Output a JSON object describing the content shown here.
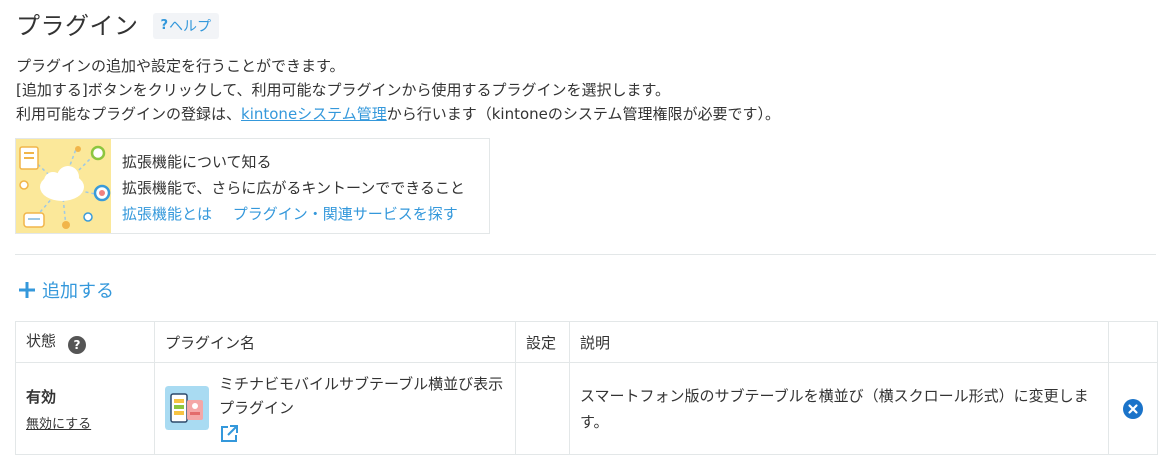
{
  "header": {
    "title": "プラグイン",
    "help_label": "ヘルプ",
    "help_prefix": "?"
  },
  "description": {
    "line1": "プラグインの追加や設定を行うことができます。",
    "line2": "[追加する]ボタンをクリックして、利用可能なプラグインから使用するプラグインを選択します。",
    "line3_pre": "利用可能なプラグインの登録は、",
    "line3_link": "kintoneシステム管理",
    "line3_post": "から行います（kintoneのシステム管理権限が必要です）。"
  },
  "promo": {
    "heading": "拡張機能について知る",
    "subheading": "拡張機能で、さらに広がるキントーンでできること",
    "link1": "拡張機能とは",
    "link2": "プラグイン・関連サービスを探す"
  },
  "add_button": {
    "label": "追加する"
  },
  "table": {
    "headers": {
      "status": "状態",
      "name": "プラグイン名",
      "settings": "設定",
      "description": "説明"
    },
    "rows": [
      {
        "status": "有効",
        "toggle_label": "無効にする",
        "name": "ミチナビモバイルサブテーブル横並び表示プラグイン",
        "description": "スマートフォン版のサブテーブルを横並び（横スクロール形式）に変更します。"
      }
    ]
  },
  "colors": {
    "link": "#3498db",
    "text": "#333333",
    "border": "#e3e7e8"
  }
}
